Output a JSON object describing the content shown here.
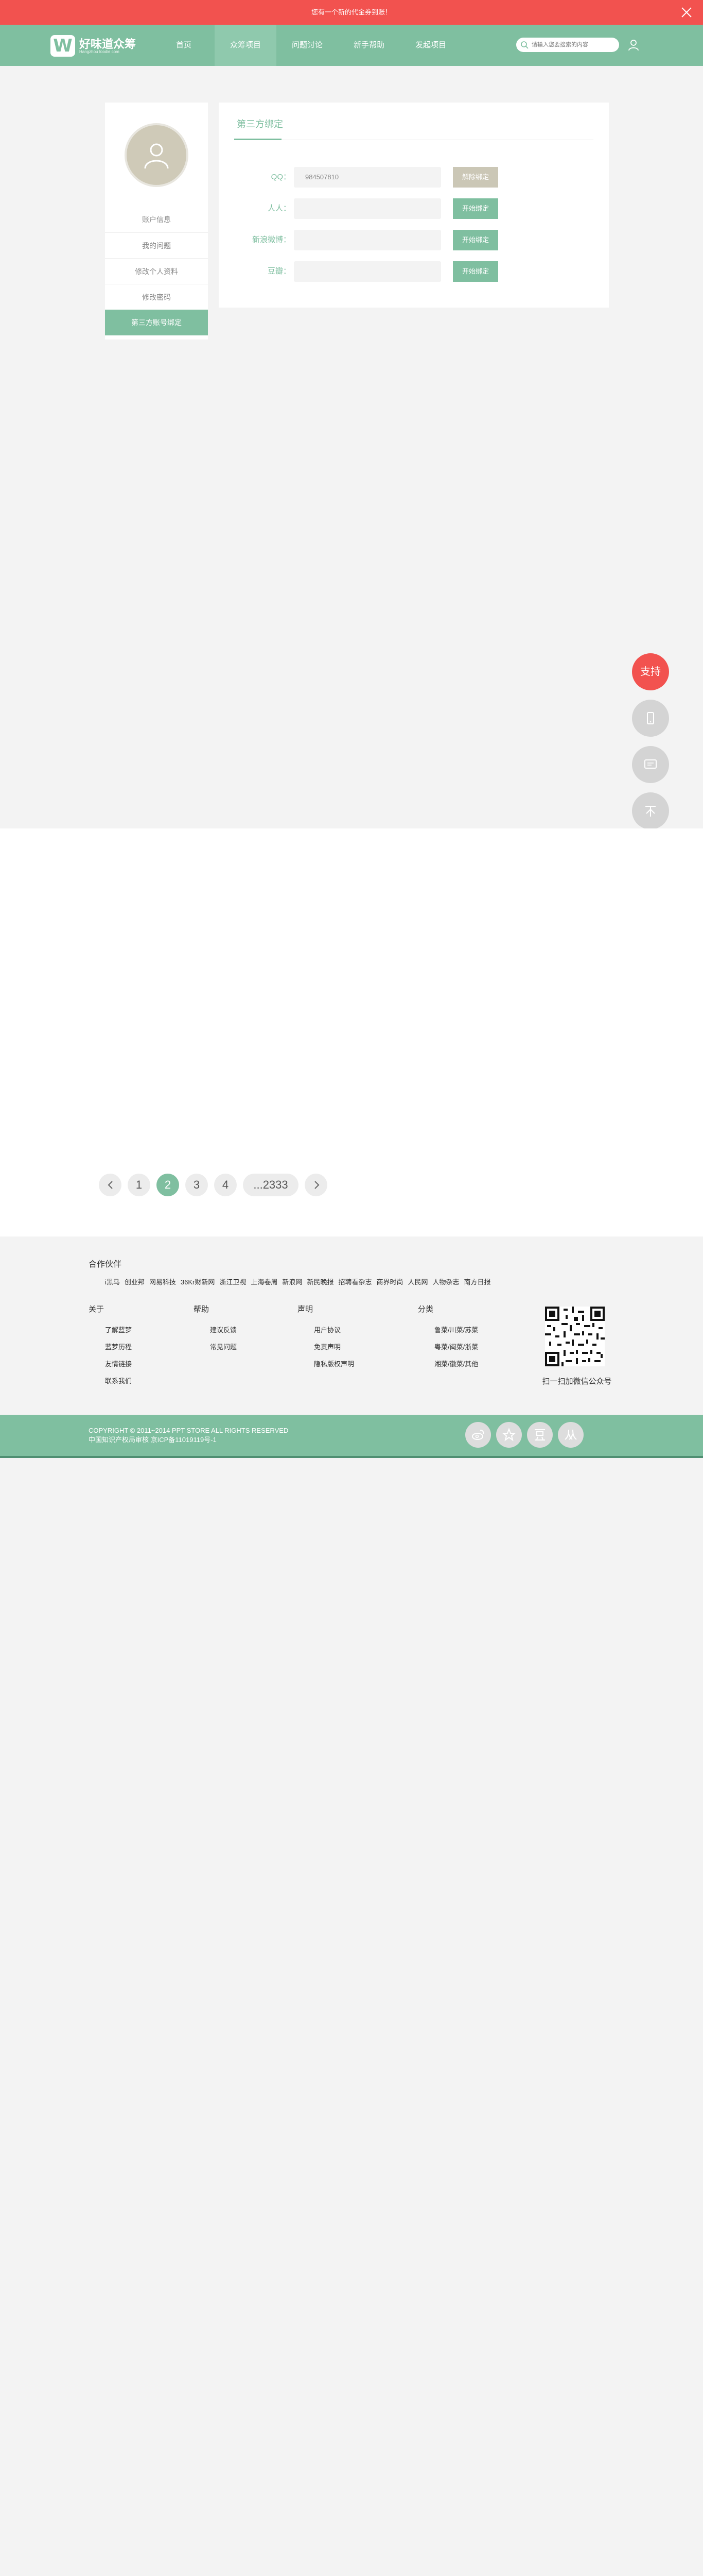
{
  "promo": {
    "text": "您有一个新的代金券到账！"
  },
  "brand": {
    "name": "好味道众筹",
    "sub": "Hangzhou foodie com",
    "mark": "W"
  },
  "nav": [
    {
      "label": "首页"
    },
    {
      "label": "众筹项目"
    },
    {
      "label": "问题讨论"
    },
    {
      "label": "新手帮助"
    },
    {
      "label": "发起项目"
    }
  ],
  "search": {
    "placeholder": "请输入您要搜索的内容"
  },
  "sidebar": {
    "items": [
      {
        "label": "账户信息"
      },
      {
        "label": "我的问题"
      },
      {
        "label": "修改个人资料"
      },
      {
        "label": "修改密码"
      },
      {
        "label": "第三方账号绑定"
      }
    ]
  },
  "binding": {
    "title": "第三方绑定",
    "rows": [
      {
        "label": "QQ：",
        "value": "984507810",
        "action": "解除绑定"
      },
      {
        "label": "人人：",
        "value": "",
        "action": "开始绑定"
      },
      {
        "label": "新浪微博：",
        "value": "",
        "action": "开始绑定"
      },
      {
        "label": "豆瓣：",
        "value": "",
        "action": "开始绑定"
      }
    ]
  },
  "floatbar": {
    "support": "支持"
  },
  "pager": {
    "pages": [
      "1",
      "2",
      "3",
      "4",
      "...2333"
    ],
    "current": "2"
  },
  "partners": {
    "title": "合作伙伴",
    "items": [
      "i黑马",
      "创业邦",
      "网易科技",
      "36Kr财新网",
      "浙江卫视",
      "上海卷周",
      "新浪网",
      "新民晚报",
      "招聘看杂志",
      "商界时尚",
      "人民网",
      "人物杂志",
      "南方日报"
    ]
  },
  "footer_cols": [
    {
      "title": "关于",
      "links": [
        "了解蓝梦",
        "蓝梦历程",
        "友情链接",
        "联系我们"
      ]
    },
    {
      "title": "帮助",
      "links": [
        "建议反馈",
        "常见问题"
      ]
    },
    {
      "title": "声明",
      "links": [
        "用户协议",
        "免责声明",
        "隐私版权声明"
      ]
    },
    {
      "title": "分类",
      "links": [
        "鲁菜/川菜/苏菜",
        "粤菜/闽菜/浙菜",
        "湘菜/徽菜/其他"
      ]
    }
  ],
  "qr": {
    "caption": "扫一扫加微信公众号"
  },
  "copyright": {
    "line1": "COPYRIGHT © 2011~2014 PPT STORE ALL RIGHTS RESERVED",
    "line2": "中国知识产权局审核    京ICP备11019119号-1"
  },
  "colors": {
    "accent": "#7fbfa0",
    "promo": "#f2524f",
    "unbind": "#cbc7b6"
  }
}
